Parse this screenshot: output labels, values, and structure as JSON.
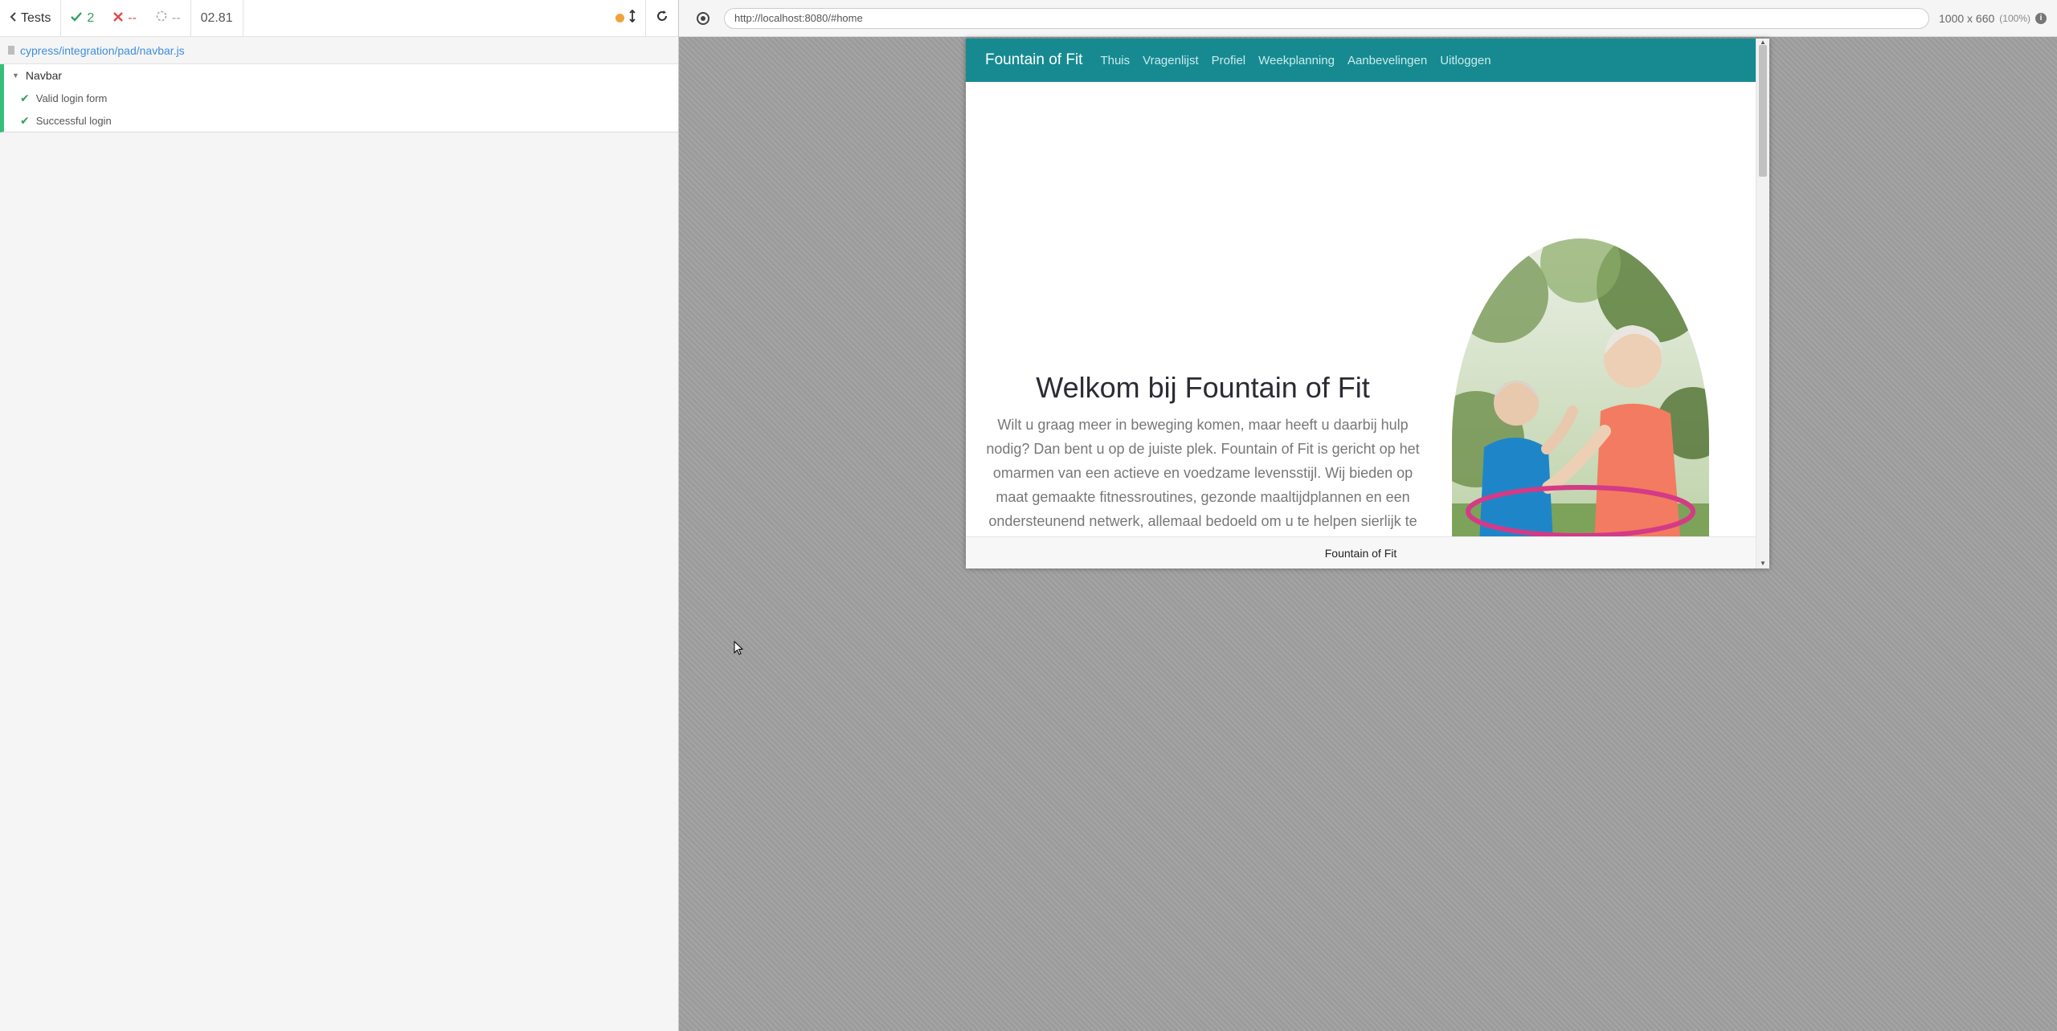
{
  "reporter": {
    "back_label": "Tests",
    "passed_count": "2",
    "failed_count": "--",
    "pending_count": "--",
    "duration": "02.81",
    "spec_path": "cypress/integration/pad/navbar.js",
    "suite": {
      "title": "Navbar",
      "tests": [
        {
          "title": "Valid login form",
          "state": "passed"
        },
        {
          "title": "Successful login",
          "state": "passed"
        }
      ]
    }
  },
  "aut": {
    "url": "http://localhost:8080/#home",
    "viewport_size": "1000 x 660",
    "viewport_scale": "(100%)"
  },
  "app": {
    "brand": "Fountain of Fit",
    "nav": [
      "Thuis",
      "Vragenlijst",
      "Profiel",
      "Weekplanning",
      "Aanbevelingen",
      "Uitloggen"
    ],
    "hero_title": "Welkom bij Fountain of Fit",
    "hero_body": "Wilt u graag meer in beweging komen, maar heeft u daarbij hulp nodig? Dan bent u op de juiste plek. Fountain of Fit is gericht op het omarmen van een actieve en voedzame levensstijl. Wij bieden op maat gemaakte fitnessroutines, gezonde maaltijdplannen en een ondersteunend netwerk, allemaal bedoeld om u te helpen sierlijk te verouderen en te floreren in uw gouden jaren.",
    "footer": "Fountain of Fit"
  },
  "colors": {
    "nav_bg": "#178a91",
    "pass": "#2da35a",
    "fail": "#e04b4b",
    "suite_border": "#35c07a",
    "link": "#3e8edb"
  }
}
